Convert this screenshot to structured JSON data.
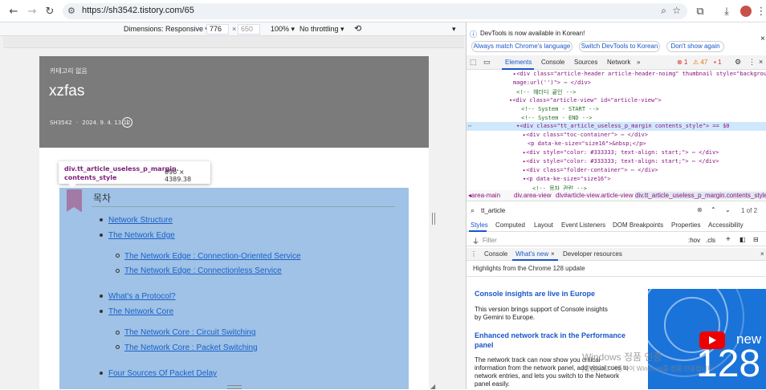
{
  "browser": {
    "url": "https://sh3542.tistory.com/65",
    "nav_back": "←",
    "nav_forward": "→",
    "nav_reload": "↻"
  },
  "device_toolbar": {
    "dimensions_label": "Dimensions: Responsive ▾",
    "width": "776",
    "times": "×",
    "height": "650",
    "zoom": "100% ▾",
    "throttling": "No throttling ▾"
  },
  "page": {
    "category": "카테고리 없음",
    "title": "xzfas",
    "author": "SH3542",
    "separator": "·",
    "date": "2024. 9. 4. 13:12",
    "toc_title": "목차",
    "toc_items": [
      "Network Structure",
      "The Network Edge",
      "The Network Edge : Connection-Oriented Service",
      "The Network Edge : Connectionless Service",
      "What's a Protocol?",
      "The Network Core",
      "The Network Core : Circuit Switching",
      "The Network Core : Packet Switching",
      "Four Sources Of Packet Delay"
    ]
  },
  "tooltip": {
    "class_text": "div.tt_article_useless_p_margin.\ncontents_style",
    "dims": "696 × 4389.38"
  },
  "devtools": {
    "notice": "DevTools is now available in Korean!",
    "btn_match": "Always match Chrome's language",
    "btn_switch": "Switch DevTools to Korean",
    "btn_dont": "Don't show again",
    "tabs": [
      "Elements",
      "Console",
      "Sources",
      "Network",
      "»"
    ],
    "errors": "1",
    "warnings": "47",
    "issues": "1",
    "code_lines": [
      "▸<div class=\"article-header article-header-noimg\" thumbnail style=\"background-i",
      "mage:url('')\"> ⋯ </div>",
      "<!-- 헤더디 끝인 -->",
      "▾<div class=\"article-view\" id=\"article-view\">",
      "<!-- System - START -->",
      "<!-- System - END -->",
      "▾<div class=\"tt_article_useless_p_margin contents_style\"> == $0",
      "▸<div class=\"toc-container\"> ⋯ </div>",
      "<p data-ke-size=\"size16\">&nbsp;</p>",
      "▸<div style=\"color: #333333; text-align: start;\"> ⋯ </div>",
      "▸<div style=\"color: #333333; text-align: start;\"> ⋯ </div>",
      "▸<div class=\"folder-container\"> ⋯ </div>",
      "▾<p data-ke-size=\"size16\">",
      "<!-- 목차 관련 -->"
    ],
    "breadcrumb": [
      "◂area-main",
      "div.area-view",
      "div#article-view.article-view",
      "div.tt_article_useless_p_margin.contents_style"
    ],
    "search_value": "tt_article",
    "search_count": "1 of 2",
    "cancel": "Cancel",
    "styles_tabs": [
      "Styles",
      "Computed",
      "Layout",
      "Event Listeners",
      "DOM Breakpoints",
      "Properties",
      "Accessibility"
    ],
    "filter_placeholder": "Filter",
    "hov": ":hov",
    "cls": ".cls",
    "drawer_tabs": [
      "Console",
      "What's new",
      "Developer resources"
    ],
    "highlights": "Highlights from the Chrome 128 update",
    "article1_title": "Console insights are live in Europe",
    "article1_body": "This version brings support of Console insights by Gemini to Europe.",
    "article2_title": "Enhanced network track in the Performance panel",
    "article2_body": "The network track can now show you critical information from the network panel, add visual cues to network entries, and lets you switch to the Network panel easily.",
    "promo_new": "new",
    "promo_num": "128"
  },
  "watermark": {
    "title": "Windows 정품 인증",
    "subtitle": "[설정]으로 이동하여 Windows를 정품 인증합니다."
  },
  "colors": {
    "accent_blue": "#1a73d9",
    "highlight": "#9fc2e6",
    "toc_mark": "#a37aa5",
    "hero_bg": "#7b7b7b"
  }
}
